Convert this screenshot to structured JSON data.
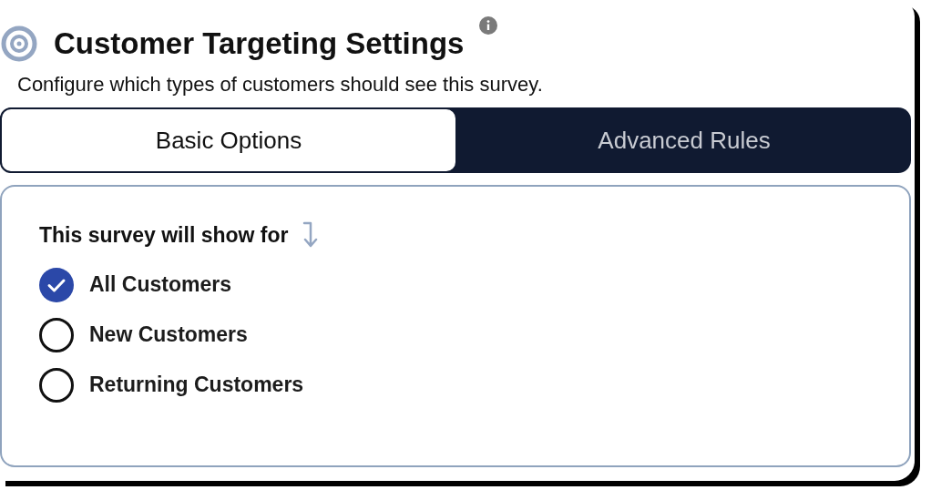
{
  "header": {
    "title": "Customer Targeting Settings",
    "subtitle": "Configure which types of customers should see this survey."
  },
  "tabs": [
    {
      "label": "Basic Options",
      "selected": true
    },
    {
      "label": "Advanced Rules",
      "selected": false
    }
  ],
  "panel": {
    "heading": "This survey will show for",
    "options": [
      {
        "label": "All Customers",
        "selected": true
      },
      {
        "label": "New Customers",
        "selected": false
      },
      {
        "label": "Returning Customers",
        "selected": false
      }
    ]
  }
}
